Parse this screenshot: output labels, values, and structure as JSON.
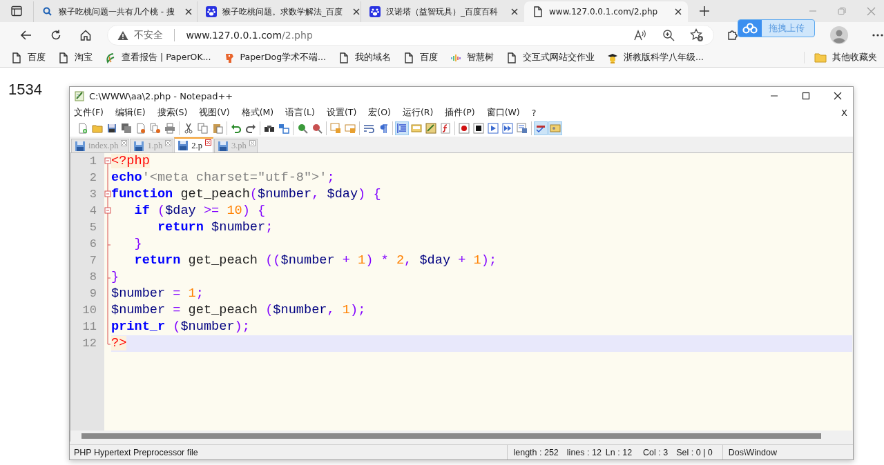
{
  "browser": {
    "tabs": [
      {
        "kind": "search",
        "title": "猴子吃桃问题一共有几个桃 - 搜",
        "selected": false
      },
      {
        "kind": "paw",
        "title": "猴子吃桃问题。求数学解法_百度",
        "selected": false
      },
      {
        "kind": "paw",
        "title": "汉诺塔（益智玩具）_百度百科",
        "selected": false
      },
      {
        "kind": "page",
        "title": "www.127.0.0.1.com/2.php",
        "selected": true
      }
    ],
    "security": "不安全",
    "url_host": "www.127.0.0.1.com",
    "url_path": "/2.php",
    "upload_widget": "拖拽上传",
    "bookmarks": [
      {
        "kind": "page",
        "label": "百度"
      },
      {
        "kind": "page",
        "label": "淘宝"
      },
      {
        "kind": "leaf",
        "label": "查看报告 | PaperOK..."
      },
      {
        "kind": "dog",
        "label": "PaperDog学术不端..."
      },
      {
        "kind": "page",
        "label": "我的域名"
      },
      {
        "kind": "page",
        "label": "百度"
      },
      {
        "kind": "bars",
        "label": "智慧树"
      },
      {
        "kind": "page",
        "label": "交互式网站交作业"
      },
      {
        "kind": "cap",
        "label": "浙教版科学八年级..."
      }
    ],
    "other_bookmarks": "其他收藏夹"
  },
  "page_output": "1534",
  "editor": {
    "title": "C:\\WWW\\aa\\2.php - Notepad++",
    "menu": [
      "文件(F)",
      "编辑(E)",
      "搜索(S)",
      "视图(V)",
      "格式(M)",
      "语言(L)",
      "设置(T)",
      "宏(O)",
      "运行(R)",
      "插件(P)",
      "窗口(W)",
      "?"
    ],
    "menu_close": "X",
    "toolbar": [
      [
        {
          "pressed": false
        },
        {
          "pressed": false
        },
        {
          "pressed": false
        },
        {
          "pressed": false
        },
        {
          "pressed": false
        },
        {
          "pressed": false
        },
        {
          "pressed": false
        }
      ],
      [
        {
          "pressed": false
        },
        {
          "pressed": false
        },
        {
          "pressed": false
        }
      ],
      [
        {
          "pressed": false
        },
        {
          "pressed": false
        }
      ],
      [
        {
          "pressed": false
        },
        {
          "pressed": false
        }
      ],
      [
        {
          "pressed": false
        },
        {
          "pressed": false
        }
      ],
      [
        {
          "pressed": false
        },
        {
          "pressed": false
        }
      ],
      [
        {
          "pressed": false
        },
        {
          "pressed": false
        }
      ],
      [
        {
          "pressed": true
        },
        {
          "pressed": false
        },
        {
          "pressed": false
        },
        {
          "pressed": false
        }
      ],
      [
        {
          "pressed": false
        },
        {
          "pressed": false
        },
        {
          "pressed": false
        },
        {
          "pressed": false
        },
        {
          "pressed": false
        }
      ],
      [
        {
          "pressed": true
        },
        {
          "pressed": true
        }
      ]
    ],
    "file_tabs": [
      {
        "label": "index.ph",
        "selected": false
      },
      {
        "label": "1.ph",
        "selected": false
      },
      {
        "label": "2.p",
        "selected": true
      },
      {
        "label": "3.ph",
        "selected": false
      }
    ],
    "lines": [
      {
        "number": "1",
        "fold_start": true,
        "fold_end": false,
        "current": false,
        "tokens": [
          {
            "kind": "php",
            "text": "<?php"
          }
        ]
      },
      {
        "number": "2",
        "fold_start": false,
        "fold_end": false,
        "current": false,
        "tokens": [
          {
            "kind": "kw",
            "text": "echo"
          },
          {
            "kind": "str",
            "text": "'<meta charset=\"utf-8\">'"
          },
          {
            "kind": "op",
            "text": ";"
          }
        ]
      },
      {
        "number": "3",
        "fold_start": true,
        "fold_end": false,
        "current": false,
        "tokens": [
          {
            "kind": "kw",
            "text": "function"
          },
          {
            "kind": "id",
            "text": " get_peach"
          },
          {
            "kind": "op",
            "text": "("
          },
          {
            "kind": "var",
            "text": "$number"
          },
          {
            "kind": "op",
            "text": ", "
          },
          {
            "kind": "var",
            "text": "$day"
          },
          {
            "kind": "op",
            "text": ") {"
          }
        ]
      },
      {
        "number": "4",
        "fold_start": true,
        "fold_end": false,
        "current": false,
        "tokens": [
          {
            "kind": "kw",
            "text": "   if"
          },
          {
            "kind": "op",
            "text": " ("
          },
          {
            "kind": "var",
            "text": "$day"
          },
          {
            "kind": "op",
            "text": " >= "
          },
          {
            "kind": "num",
            "text": "10"
          },
          {
            "kind": "op",
            "text": ") {"
          }
        ]
      },
      {
        "number": "5",
        "fold_start": false,
        "fold_end": false,
        "current": false,
        "tokens": [
          {
            "kind": "kw",
            "text": "      return"
          },
          {
            "kind": "var",
            "text": " $number"
          },
          {
            "kind": "op",
            "text": ";"
          }
        ]
      },
      {
        "number": "6",
        "fold_start": false,
        "fold_end": true,
        "current": false,
        "tokens": [
          {
            "kind": "op",
            "text": "   }"
          }
        ]
      },
      {
        "number": "7",
        "fold_start": false,
        "fold_end": false,
        "current": false,
        "tokens": [
          {
            "kind": "kw",
            "text": "   return"
          },
          {
            "kind": "id",
            "text": " get_peach "
          },
          {
            "kind": "op",
            "text": "(("
          },
          {
            "kind": "var",
            "text": "$number"
          },
          {
            "kind": "op",
            "text": " + "
          },
          {
            "kind": "num",
            "text": "1"
          },
          {
            "kind": "op",
            "text": ") * "
          },
          {
            "kind": "num",
            "text": "2"
          },
          {
            "kind": "op",
            "text": ", "
          },
          {
            "kind": "var",
            "text": "$day"
          },
          {
            "kind": "op",
            "text": " + "
          },
          {
            "kind": "num",
            "text": "1"
          },
          {
            "kind": "op",
            "text": ");"
          }
        ]
      },
      {
        "number": "8",
        "fold_start": false,
        "fold_end": true,
        "current": false,
        "tokens": [
          {
            "kind": "op",
            "text": "}"
          }
        ]
      },
      {
        "number": "9",
        "fold_start": false,
        "fold_end": false,
        "current": false,
        "tokens": [
          {
            "kind": "var",
            "text": "$number"
          },
          {
            "kind": "op",
            "text": " = "
          },
          {
            "kind": "num",
            "text": "1"
          },
          {
            "kind": "op",
            "text": ";"
          }
        ]
      },
      {
        "number": "10",
        "fold_start": false,
        "fold_end": false,
        "current": false,
        "tokens": [
          {
            "kind": "var",
            "text": "$number"
          },
          {
            "kind": "op",
            "text": " ="
          },
          {
            "kind": "id",
            "text": " get_peach "
          },
          {
            "kind": "op",
            "text": "("
          },
          {
            "kind": "var",
            "text": "$number"
          },
          {
            "kind": "op",
            "text": ", "
          },
          {
            "kind": "num",
            "text": "1"
          },
          {
            "kind": "op",
            "text": ");"
          }
        ]
      },
      {
        "number": "11",
        "fold_start": false,
        "fold_end": false,
        "current": false,
        "tokens": [
          {
            "kind": "kw",
            "text": "print_r"
          },
          {
            "kind": "op",
            "text": " ("
          },
          {
            "kind": "var",
            "text": "$number"
          },
          {
            "kind": "op",
            "text": ");"
          }
        ]
      },
      {
        "number": "12",
        "fold_start": false,
        "fold_end": true,
        "current": true,
        "tokens": [
          {
            "kind": "php",
            "text": "?>"
          }
        ]
      }
    ],
    "status": {
      "file_type": "PHP Hypertext Preprocessor file",
      "length": "length : 252",
      "lines": "lines : 12",
      "position": "Ln : 12",
      "column": "Col : 3",
      "selection": "Sel : 0 | 0",
      "eol": "Dos\\Window"
    }
  }
}
